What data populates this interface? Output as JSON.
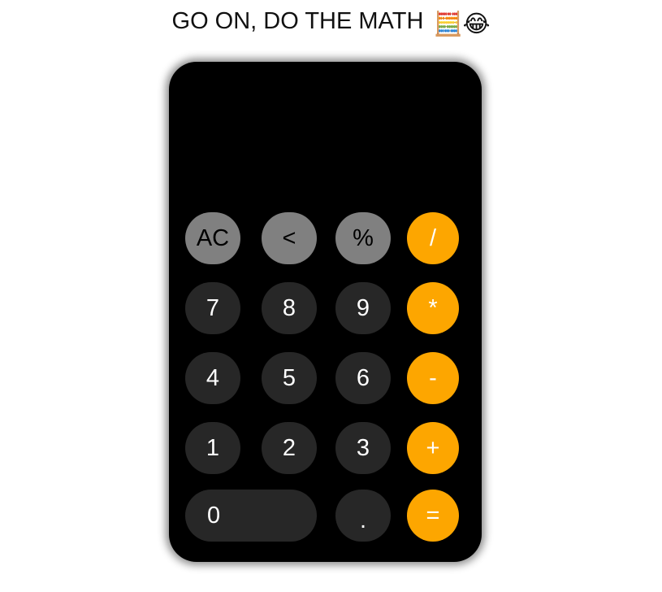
{
  "heading": {
    "text": "GO ON, DO THE MATH",
    "emoji": "🧮😂"
  },
  "display": {
    "value": ""
  },
  "colors": {
    "calculator_body": "#000000",
    "function_key": "#808080",
    "number_key": "#272727",
    "operator_key": "#fda600"
  },
  "keys": {
    "ac": "AC",
    "backspace": "<",
    "percent": "%",
    "divide": "/",
    "seven": "7",
    "eight": "8",
    "nine": "9",
    "multiply": "*",
    "four": "4",
    "five": "5",
    "six": "6",
    "subtract": "-",
    "one": "1",
    "two": "2",
    "three": "3",
    "add": "+",
    "zero": "0",
    "decimal": ".",
    "equals": "="
  }
}
